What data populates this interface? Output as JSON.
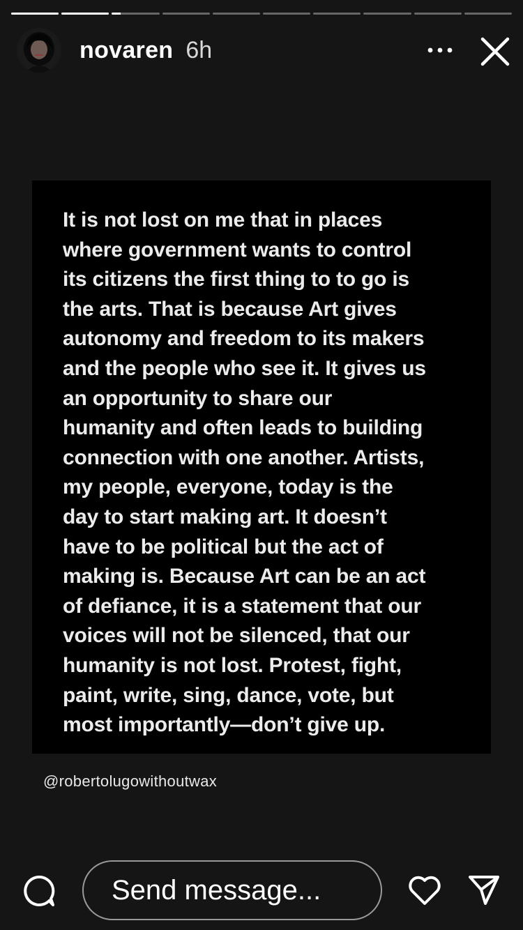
{
  "story": {
    "segments_total": 10,
    "active_segment": 3,
    "active_progress": 0.18,
    "username": "novaren",
    "time_ago": "6h",
    "quote": "It is not lost on me that in places\nwhere government wants to control\nits citizens the first thing to to go is\nthe arts. That is because Art gives\nautonomy and freedom to its makers\nand the people who see it. It gives us\nan opportunity to share our\nhumanity and often leads to building\nconnection with one another. Artists,\nmy people, everyone, today is the\nday to start making art. It doesn’t\nhave to be political but the act of\nmaking is. Because Art can be an act\nof defiance, it is a statement that our\nvoices will not be silenced, that our\nhumanity is not lost. Protest, fight,\npaint, write, sing, dance, vote, but\nmost importantly—don’t give up.",
    "credit": "@robertolugowithoutwax"
  },
  "footer": {
    "message_placeholder": "Send message..."
  },
  "icons": {
    "more": "more-horizontal-icon",
    "close": "close-icon",
    "comment": "comment-icon",
    "like": "heart-icon",
    "send": "send-icon"
  },
  "colors": {
    "background": "#151515",
    "card": "#000000",
    "text": "#ffffff"
  }
}
